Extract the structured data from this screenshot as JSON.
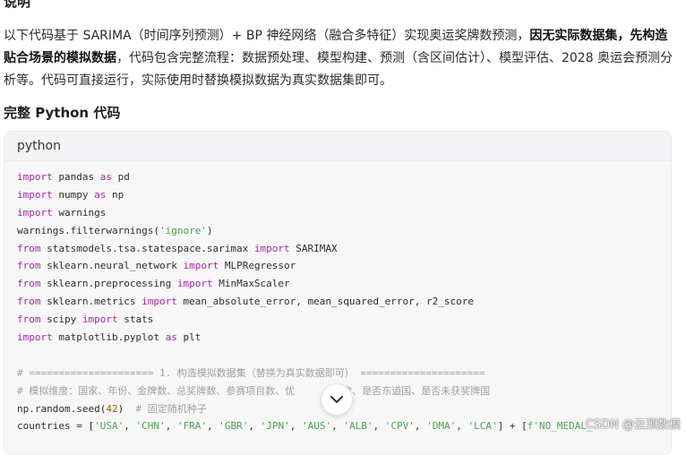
{
  "section": {
    "heading": "说明",
    "intro_part1": "以下代码基于 SARIMA（时间序列预测）+ BP 神经网络（融合多特征）实现奥运奖牌数预测，",
    "intro_bold": "因无实际数据集，先构造贴合场景的模拟数据",
    "intro_part2": "，代码包含完整流程：数据预处理、模型构建、预测（含区间估计）、模型评估、2028 奥运会预测分析等。代码可直接运行，实际使用时替换模拟数据为真实数据集即可。"
  },
  "code_section": {
    "heading": "完整 Python 代码",
    "language": "python",
    "lines": [
      [
        {
          "t": "import",
          "c": "kw"
        },
        {
          "t": " pandas ",
          "c": ""
        },
        {
          "t": "as",
          "c": "kw"
        },
        {
          "t": " pd",
          "c": ""
        }
      ],
      [
        {
          "t": "import",
          "c": "kw"
        },
        {
          "t": " numpy ",
          "c": ""
        },
        {
          "t": "as",
          "c": "kw"
        },
        {
          "t": " np",
          "c": ""
        }
      ],
      [
        {
          "t": "import",
          "c": "kw"
        },
        {
          "t": " warnings",
          "c": ""
        }
      ],
      [
        {
          "t": "warnings.filterwarnings(",
          "c": ""
        },
        {
          "t": "'ignore'",
          "c": "str"
        },
        {
          "t": ")",
          "c": ""
        }
      ],
      [
        {
          "t": "from",
          "c": "kw"
        },
        {
          "t": " statsmodels.tsa.statespace.sarimax ",
          "c": ""
        },
        {
          "t": "import",
          "c": "kw"
        },
        {
          "t": " SARIMAX",
          "c": ""
        }
      ],
      [
        {
          "t": "from",
          "c": "kw"
        },
        {
          "t": " sklearn.neural_network ",
          "c": ""
        },
        {
          "t": "import",
          "c": "kw"
        },
        {
          "t": " MLPRegressor",
          "c": ""
        }
      ],
      [
        {
          "t": "from",
          "c": "kw"
        },
        {
          "t": " sklearn.preprocessing ",
          "c": ""
        },
        {
          "t": "import",
          "c": "kw"
        },
        {
          "t": " MinMaxScaler",
          "c": ""
        }
      ],
      [
        {
          "t": "from",
          "c": "kw"
        },
        {
          "t": " sklearn.metrics ",
          "c": ""
        },
        {
          "t": "import",
          "c": "kw"
        },
        {
          "t": " mean_absolute_error, mean_squared_error, r2_score",
          "c": ""
        }
      ],
      [
        {
          "t": "from",
          "c": "kw"
        },
        {
          "t": " scipy ",
          "c": ""
        },
        {
          "t": "import",
          "c": "kw"
        },
        {
          "t": " stats",
          "c": ""
        }
      ],
      [
        {
          "t": "import",
          "c": "kw"
        },
        {
          "t": " matplotlib.pyplot ",
          "c": ""
        },
        {
          "t": "as",
          "c": "kw"
        },
        {
          "t": " plt",
          "c": ""
        }
      ],
      [
        {
          "t": "",
          "c": ""
        }
      ],
      [
        {
          "t": "# ===================== 1. 构造模拟数据集（替换为真实数据即可） =====================",
          "c": "cm"
        }
      ],
      [
        {
          "t": "# 模拟维度：国家、年份、金牌数、总奖牌数、参赛项目数、优        数、是否东道国、是否未获奖牌国",
          "c": "cm"
        }
      ],
      [
        {
          "t": "np.random.seed(",
          "c": ""
        },
        {
          "t": "42",
          "c": "num"
        },
        {
          "t": ")  ",
          "c": ""
        },
        {
          "t": "# 固定随机种子",
          "c": "cm"
        }
      ],
      [
        {
          "t": "countries = [",
          "c": ""
        },
        {
          "t": "'USA'",
          "c": "str"
        },
        {
          "t": ", ",
          "c": ""
        },
        {
          "t": "'CHN'",
          "c": "str"
        },
        {
          "t": ", ",
          "c": ""
        },
        {
          "t": "'FRA'",
          "c": "str"
        },
        {
          "t": ", ",
          "c": ""
        },
        {
          "t": "'GBR'",
          "c": "str"
        },
        {
          "t": ", ",
          "c": ""
        },
        {
          "t": "'JPN'",
          "c": "str"
        },
        {
          "t": ", ",
          "c": ""
        },
        {
          "t": "'AUS'",
          "c": "str"
        },
        {
          "t": ", ",
          "c": ""
        },
        {
          "t": "'ALB'",
          "c": "str"
        },
        {
          "t": ", ",
          "c": ""
        },
        {
          "t": "'CPV'",
          "c": "str"
        },
        {
          "t": ", ",
          "c": ""
        },
        {
          "t": "'DMA'",
          "c": "str"
        },
        {
          "t": ", ",
          "c": ""
        },
        {
          "t": "'LCA'",
          "c": "str"
        },
        {
          "t": "] + [",
          "c": ""
        },
        {
          "t": "f'NO_MEDAL_",
          "c": "str"
        }
      ]
    ]
  },
  "watermark": "CSDN @云顶数模",
  "icons": {
    "scroll_down": "chevron-down-icon"
  }
}
